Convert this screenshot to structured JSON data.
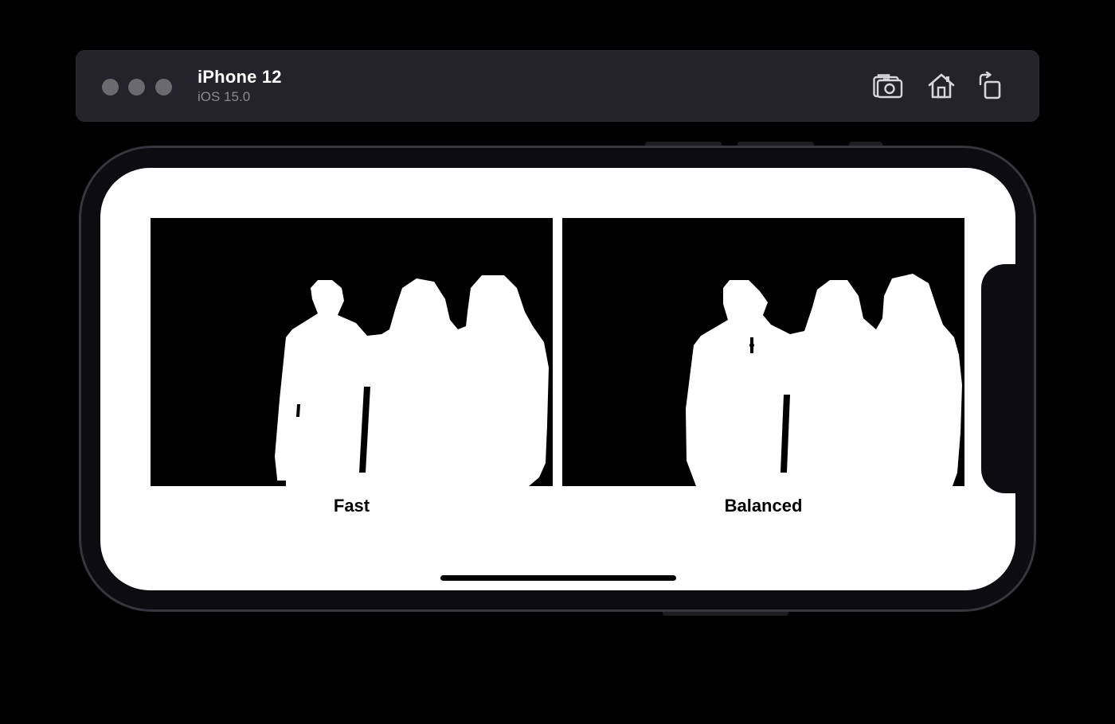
{
  "window": {
    "device_name": "iPhone 12",
    "os_version": "iOS 15.0"
  },
  "toolbar": {
    "buttons": [
      {
        "name": "screenshot",
        "icon": "camera-icon"
      },
      {
        "name": "home",
        "icon": "home-icon"
      },
      {
        "name": "rotate",
        "icon": "rotate-icon"
      }
    ]
  },
  "app": {
    "panels": [
      {
        "caption": "Fast",
        "image": "person-segmentation-mask"
      },
      {
        "caption": "Balanced",
        "image": "person-segmentation-mask"
      }
    ]
  },
  "colors": {
    "titlebar": "#24222a",
    "traffic_light": "#6b6a6f",
    "screen_background": "#ffffff",
    "mask_background": "#000000",
    "mask_foreground": "#ffffff"
  }
}
